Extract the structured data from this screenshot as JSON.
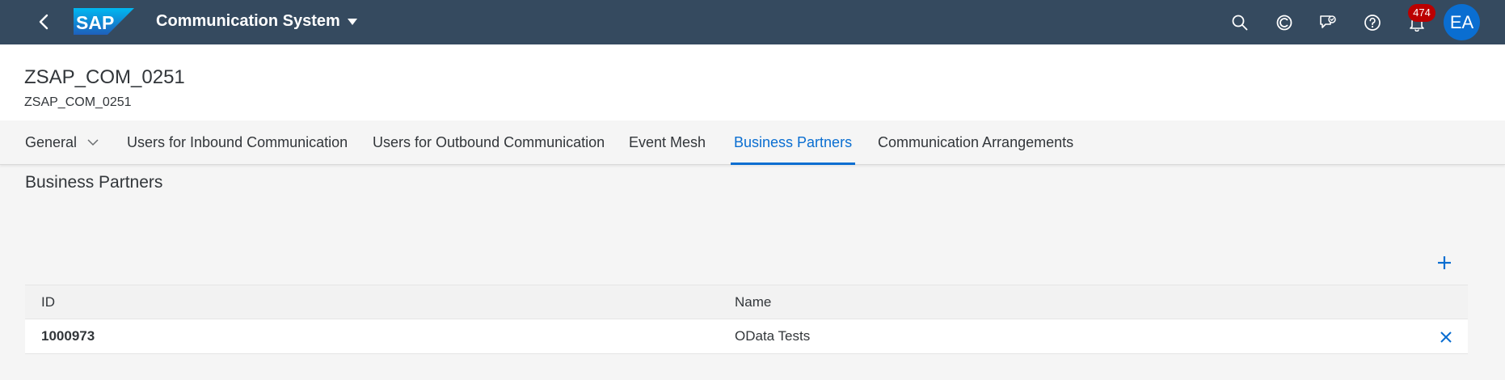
{
  "shell": {
    "logo_text": "SAP",
    "app_title": "Communication System",
    "notification_count": "474",
    "avatar_initials": "EA"
  },
  "header": {
    "title": "ZSAP_COM_0251",
    "subtitle": "ZSAP_COM_0251"
  },
  "tabs": [
    {
      "label": "General"
    },
    {
      "label": "Users for Inbound Communication"
    },
    {
      "label": "Users for Outbound Communication"
    },
    {
      "label": "Event Mesh"
    },
    {
      "label": "Business Partners",
      "active": true
    },
    {
      "label": "Communication Arrangements"
    }
  ],
  "section": {
    "title": "Business Partners"
  },
  "table": {
    "columns": [
      "ID",
      "Name"
    ],
    "rows": [
      {
        "id": "1000973",
        "name": "OData Tests"
      }
    ]
  },
  "colors": {
    "shell_bg": "#354a5f",
    "accent": "#0a6ed1",
    "badge": "#bb0000"
  },
  "icons": [
    "back-icon",
    "caret-down-icon",
    "search-icon",
    "copilot-icon",
    "feedback-icon",
    "help-icon",
    "bell-icon",
    "chevron-down-icon",
    "add-icon",
    "delete-icon"
  ]
}
